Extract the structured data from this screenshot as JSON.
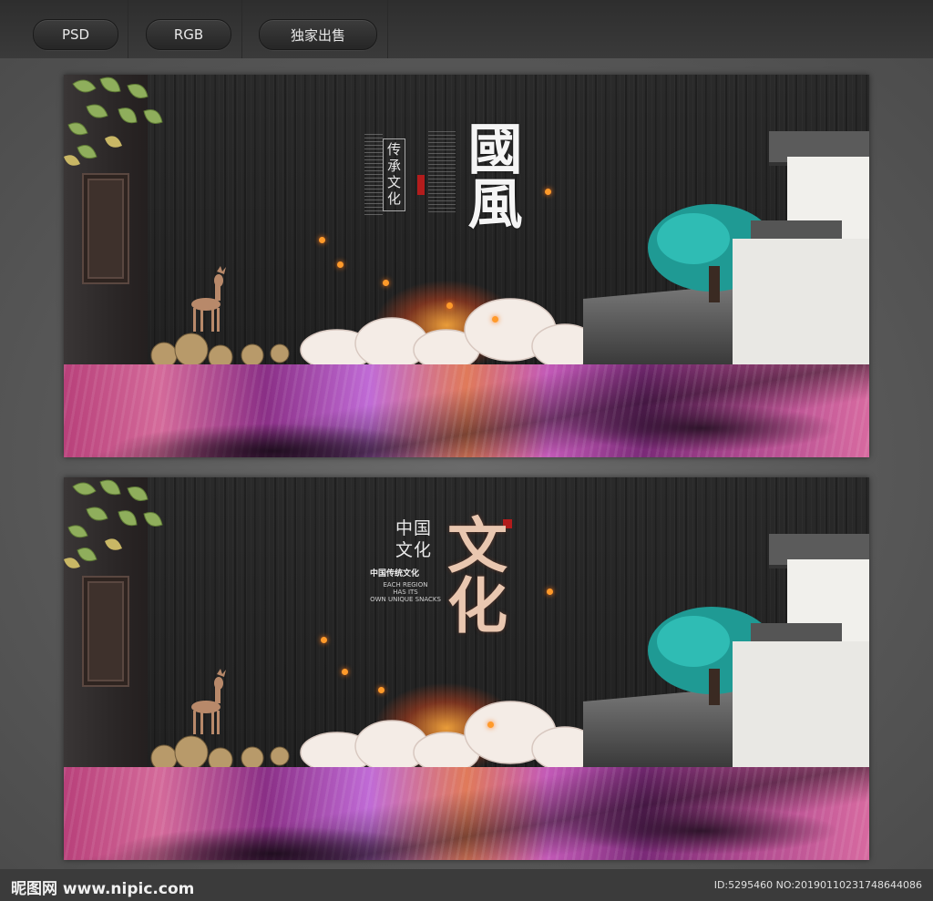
{
  "toolbar": {
    "tabs": [
      "PSD",
      "RGB",
      "独家出售"
    ]
  },
  "banners": [
    {
      "headline": "國風",
      "tagline": "传承文化"
    },
    {
      "headline": "文化",
      "subtitle_cn": "中国文化",
      "tagline": "中国传统文化",
      "english": [
        "EACH REGION",
        "HAS ITS",
        "OWN UNIQUE SNACKS"
      ]
    }
  ],
  "footer": {
    "logo_text": "昵图网 www.nipic.com",
    "id_text": "ID:5295460 NO:20190110231748644086"
  },
  "colors": {
    "ember": "#ff9a2a",
    "fabric_magenta": "#c35ab8",
    "tree_teal": "#1f9a94",
    "seal_red": "#b31c1c"
  }
}
